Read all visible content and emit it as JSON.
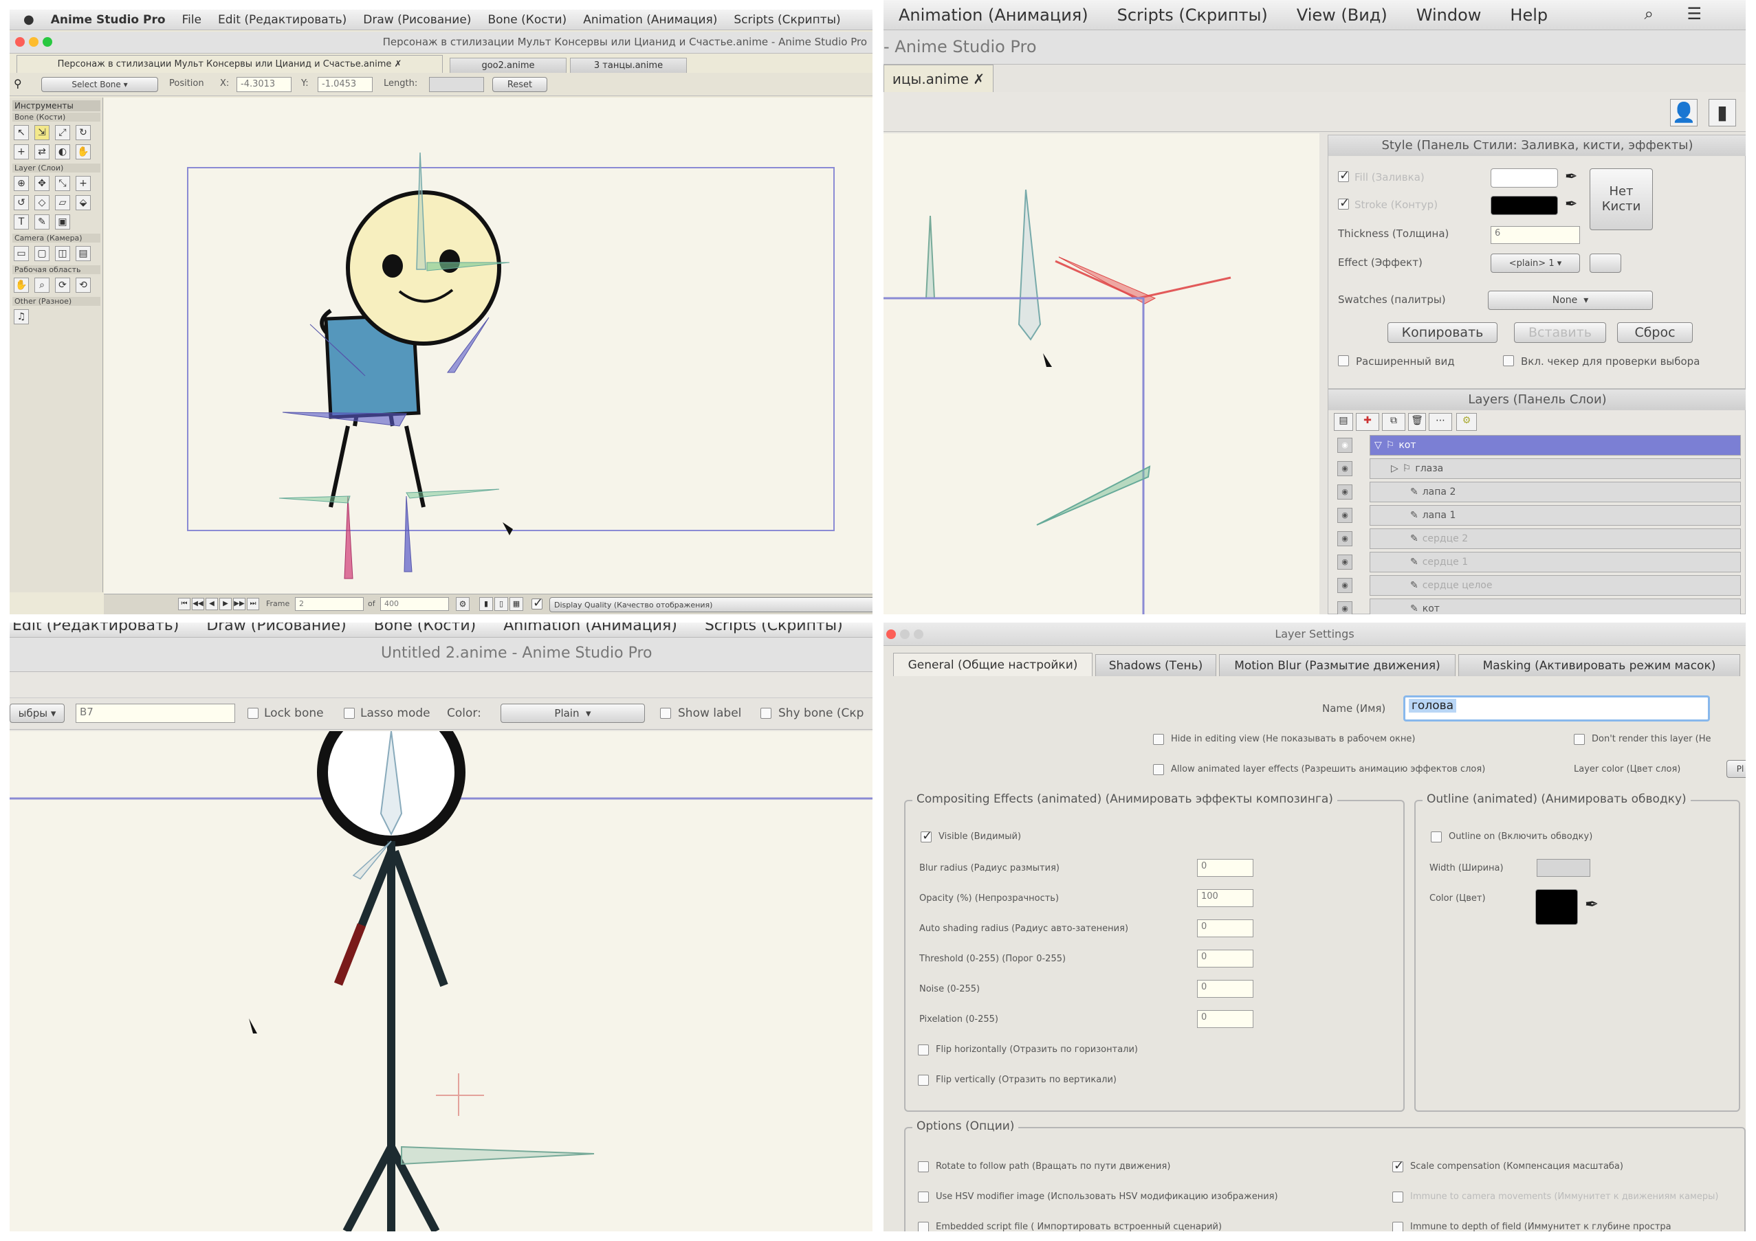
{
  "p1": {
    "app_name": "Anime Studio Pro",
    "menu": [
      "File",
      "Edit (Редактировать)",
      "Draw (Рисование)",
      "Bone (Кости)",
      "Animation (Анимация)",
      "Scripts (Скрипты)"
    ],
    "window_title": "Персонаж в стилизации Мульт Консервы или Цианид и Счастье.anime - Anime Studio Pro",
    "tabs": [
      "Персонаж в стилизации Мульт Консервы или Цианид и Счастье.anime ✗",
      "goo2.anime",
      "3 танцы.anime"
    ],
    "toolbar": {
      "select_bone": "Select Bone",
      "position_label": "Position",
      "x_label": "X:",
      "x_value": "-4.3013",
      "y_label": "Y:",
      "y_value": "-1.0453",
      "length_label": "Length:",
      "reset": "Reset"
    },
    "tools_title": "Инструменты",
    "tool_sections": [
      "Bone (Кости)",
      "Layer (Слои)",
      "Camera (Камера)",
      "Рабочая область",
      "Other (Разное)"
    ],
    "timeline": {
      "frame_label": "Frame",
      "frame_value": "2",
      "of_label": "of",
      "of_value": "400",
      "quality": "Display Quality (Качество отображения)"
    }
  },
  "p2": {
    "menu": [
      "Animation (Анимация)",
      "Scripts (Скрипты)",
      "View (Вид)",
      "Window",
      "Help"
    ],
    "window_title": "- Anime Studio Pro",
    "tab": "ицы.anime ✗",
    "style": {
      "title": "Style (Панель Стили: Заливка, кисти, эффекты)",
      "fill": "Fill (Заливка)",
      "stroke": "Stroke (Контур)",
      "fill_color": "#ffffff",
      "stroke_color": "#000000",
      "no_brush": "Нет Кисти",
      "thickness_label": "Thickness (Толщина)",
      "thickness_value": "6",
      "effect_label": "Effect (Эффект)",
      "effect_value": "<plain> 1",
      "swatches_label": "Swatches (палитры)",
      "swatches_value": "None",
      "copy": "Копировать",
      "paste": "Вставить",
      "reset": "Сброс",
      "advanced": "Расширенный вид",
      "checker": "Вкл. чекер для проверки выбора"
    },
    "layers": {
      "title": "Layers (Панель Слои)",
      "items": [
        "кот",
        "глаза",
        "лапа 2",
        "лапа 1",
        "сердце 2",
        "сердце 1",
        "сердце целое",
        "кот"
      ]
    }
  },
  "p3": {
    "menu": [
      "Edit (Редактировать)",
      "Draw (Рисование)",
      "Bone (Кости)",
      "Animation (Анимация)",
      "Scripts (Скрипты)"
    ],
    "window_title": "Untitled 2.anime - Anime Studio Pro",
    "toolbar": {
      "select_value": "ыбры",
      "name_value": "B7",
      "lock_bone": "Lock bone",
      "lasso": "Lasso mode",
      "color_label": "Color:",
      "color_value": "Plain",
      "show_label": "Show label",
      "shy_bone": "Shy bone (Скр"
    }
  },
  "p4": {
    "title": "Layer Settings",
    "tabs": [
      "General (Общие настройки)",
      "Shadows (Тень)",
      "Motion Blur (Размытие движения)",
      "Masking (Активировать режим масок)"
    ],
    "name_label": "Name (Имя)",
    "name_value": "голова",
    "hide_editing": "Hide in editing view (Не показывать в рабочем окне)",
    "dont_render": "Don't render this layer (Не",
    "allow_effects": "Allow animated layer effects (Разрешить анимацию эффектов слоя)",
    "layer_color": "Layer color (Цвет слоя)",
    "compositing": {
      "title": "Compositing Effects (animated) (Анимировать эффекты композинга)",
      "visible": "Visible (Видимый)",
      "fields": [
        {
          "label": "Blur radius (Радиус размытия)",
          "value": "0"
        },
        {
          "label": "Opacity (%) (Непрозрачность)",
          "value": "100"
        },
        {
          "label": "Auto shading radius (Радиус авто-затенения)",
          "value": "0"
        },
        {
          "label": "Threshold (0-255) (Порог 0-255)",
          "value": "0"
        },
        {
          "label": "Noise (0-255)",
          "value": "0"
        },
        {
          "label": "Pixelation (0-255)",
          "value": "0"
        }
      ],
      "flip_h": "Flip horizontally (Отразить по горизонтали)",
      "flip_v": "Flip vertically (Отразить по вертикали)"
    },
    "outline": {
      "title": "Outline (animated) (Анимировать обводку)",
      "on": "Outline on (Включить обводку)",
      "width_label": "Width (Ширина)",
      "color_label": "Color (Цвет)",
      "color": "#000000"
    },
    "options": {
      "title": "Options (Опции)",
      "rotate": "Rotate to follow path (Вращать по пути движения)",
      "hsv": "Use HSV modifier image (Использовать HSV модификацию изображения)",
      "embedded": "Embedded script file ( Импортировать встроенный сценарий)",
      "scale": "Scale compensation (Компенсация масштаба)",
      "immune_camera": "Immune to camera movements (Иммунитет к движениям камеры)",
      "immune_depth": "Immune to depth of field (Иммунитет к глубине простра"
    }
  }
}
